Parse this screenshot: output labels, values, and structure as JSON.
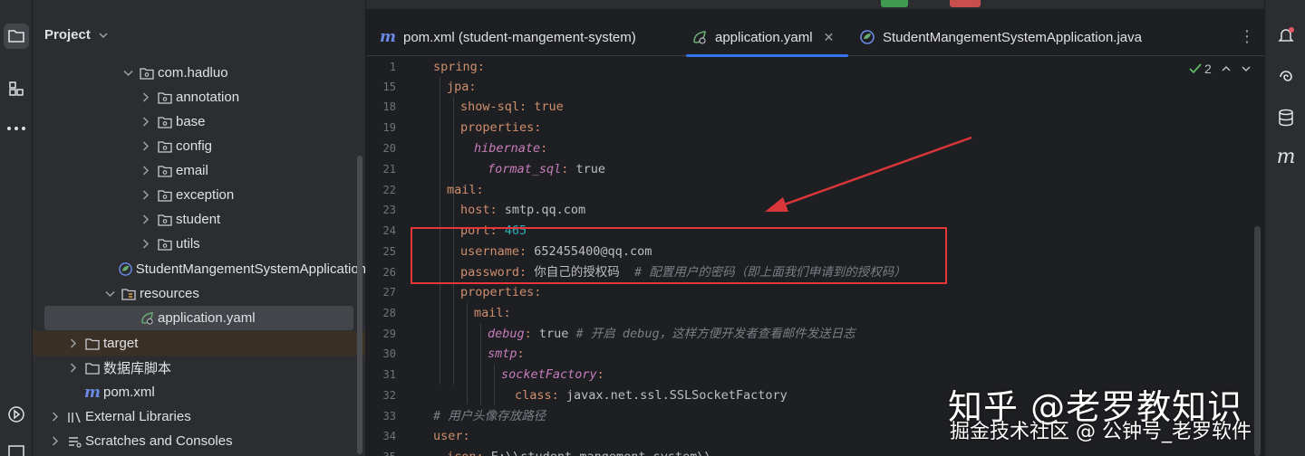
{
  "project_panel": {
    "title": "Project",
    "tree": [
      {
        "label": "com.hadluo",
        "kind": "package",
        "expanded": true
      },
      {
        "label": "annotation",
        "kind": "package",
        "expanded": false
      },
      {
        "label": "base",
        "kind": "package",
        "expanded": false
      },
      {
        "label": "config",
        "kind": "package",
        "expanded": false
      },
      {
        "label": "email",
        "kind": "package",
        "expanded": false
      },
      {
        "label": "exception",
        "kind": "package",
        "expanded": false
      },
      {
        "label": "student",
        "kind": "package",
        "expanded": false
      },
      {
        "label": "utils",
        "kind": "package",
        "expanded": false
      },
      {
        "label": "StudentMangementSystemApplication",
        "kind": "spring-boot-class"
      },
      {
        "label": "resources",
        "kind": "resources-folder",
        "expanded": true
      },
      {
        "label": "application.yaml",
        "kind": "yaml-file",
        "selected": true
      },
      {
        "label": "target",
        "kind": "folder",
        "expanded": false
      },
      {
        "label": "数据库脚本",
        "kind": "folder",
        "expanded": false
      },
      {
        "label": "pom.xml",
        "kind": "maven-file"
      },
      {
        "label": "External Libraries",
        "kind": "libraries",
        "expanded": false
      },
      {
        "label": "Scratches and Consoles",
        "kind": "scratches",
        "expanded": false
      }
    ]
  },
  "editor": {
    "tabs": [
      {
        "label": "pom.xml (student-mangement-system)",
        "icon": "maven-icon",
        "active": false
      },
      {
        "label": "application.yaml",
        "icon": "spring-leaf-icon",
        "active": true
      },
      {
        "label": "StudentMangementSystemApplication.java",
        "icon": "spring-class-icon",
        "active": false
      }
    ],
    "inspection_count": "2",
    "lines": [
      {
        "n": "1",
        "indent": 0,
        "parts": [
          {
            "t": "spring:",
            "c": "k"
          }
        ]
      },
      {
        "n": "15",
        "indent": 1,
        "parts": [
          {
            "t": "jpa:",
            "c": "k"
          }
        ]
      },
      {
        "n": "18",
        "indent": 2,
        "parts": [
          {
            "t": "show-sql: true",
            "c": "k"
          }
        ]
      },
      {
        "n": "19",
        "indent": 2,
        "parts": [
          {
            "t": "properties:",
            "c": "k"
          }
        ]
      },
      {
        "n": "20",
        "indent": 3,
        "parts": [
          {
            "t": "hibernate",
            "c": "ki"
          },
          {
            "t": ":",
            "c": "k"
          }
        ]
      },
      {
        "n": "21",
        "indent": 4,
        "parts": [
          {
            "t": "format_sql",
            "c": "ki"
          },
          {
            "t": ": ",
            "c": "k"
          },
          {
            "t": "true",
            "c": "v"
          }
        ]
      },
      {
        "n": "22",
        "indent": 1,
        "parts": [
          {
            "t": "mail:",
            "c": "k"
          }
        ]
      },
      {
        "n": "23",
        "indent": 2,
        "parts": [
          {
            "t": "host: ",
            "c": "k"
          },
          {
            "t": "smtp.qq.com",
            "c": "v"
          }
        ]
      },
      {
        "n": "24",
        "indent": 2,
        "parts": [
          {
            "t": "port: ",
            "c": "k"
          },
          {
            "t": "465",
            "c": "n"
          }
        ]
      },
      {
        "n": "25",
        "indent": 2,
        "parts": [
          {
            "t": "username: ",
            "c": "k"
          },
          {
            "t": "652455400@qq.com",
            "c": "v"
          }
        ]
      },
      {
        "n": "26",
        "indent": 2,
        "parts": [
          {
            "t": "password: ",
            "c": "k"
          },
          {
            "t": "你自己的授权码  ",
            "c": "v"
          },
          {
            "t": "# 配置用户的密码（即上面我们申请到的授权码）",
            "c": "c"
          }
        ]
      },
      {
        "n": "27",
        "indent": 2,
        "parts": [
          {
            "t": "properties:",
            "c": "k"
          }
        ]
      },
      {
        "n": "28",
        "indent": 3,
        "parts": [
          {
            "t": "mail:",
            "c": "k"
          }
        ]
      },
      {
        "n": "29",
        "indent": 4,
        "parts": [
          {
            "t": "debug",
            "c": "ki"
          },
          {
            "t": ": ",
            "c": "k"
          },
          {
            "t": "true ",
            "c": "v"
          },
          {
            "t": "# 开启 debug，这样方便开发者查看邮件发送日志",
            "c": "c"
          }
        ]
      },
      {
        "n": "30",
        "indent": 4,
        "parts": [
          {
            "t": "smtp",
            "c": "ki"
          },
          {
            "t": ":",
            "c": "k"
          }
        ]
      },
      {
        "n": "31",
        "indent": 5,
        "parts": [
          {
            "t": "socketFactory",
            "c": "ki"
          },
          {
            "t": ":",
            "c": "k"
          }
        ]
      },
      {
        "n": "32",
        "indent": 6,
        "parts": [
          {
            "t": "class: ",
            "c": "k"
          },
          {
            "t": "javax.net.ssl.SSLSocketFactory",
            "c": "v"
          }
        ]
      },
      {
        "n": "33",
        "indent": 0,
        "parts": [
          {
            "t": "# 用户头像存放路径",
            "c": "c"
          }
        ]
      },
      {
        "n": "34",
        "indent": 0,
        "parts": [
          {
            "t": "user:",
            "c": "k"
          }
        ]
      },
      {
        "n": "35",
        "indent": 1,
        "parts": [
          {
            "t": "icon: ",
            "c": "k"
          },
          {
            "t": "E:\\\\student-mangement-system\\\\",
            "c": "v"
          }
        ]
      }
    ]
  },
  "watermark": {
    "line1": "知乎 @老罗教知识",
    "line2": "掘金技术社区 @ 公钟号_老罗软件"
  },
  "colors": {
    "accent": "#3574f0",
    "highlight_box": "#e5373a",
    "arrow": "#d9363a",
    "yaml_key": "#cf8e6d",
    "yaml_number": "#2aacb8",
    "comment": "#7a7e85"
  }
}
